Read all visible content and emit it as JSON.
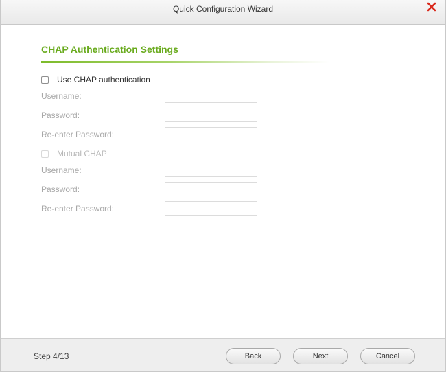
{
  "window": {
    "title": "Quick Configuration Wizard",
    "close_icon": "close-icon",
    "close_color": "#d9291c"
  },
  "section": {
    "title": "CHAP Authentication Settings",
    "accent_color": "#6aab1f"
  },
  "chap": {
    "checkbox_label": "Use CHAP authentication",
    "checked": false,
    "username_label": "Username:",
    "username_value": "",
    "password_label": "Password:",
    "password_value": "",
    "reenter_label": "Re-enter Password:",
    "reenter_value": ""
  },
  "mutual_chap": {
    "checkbox_label": "Mutual CHAP",
    "checked": false,
    "enabled": false,
    "username_label": "Username:",
    "username_value": "",
    "password_label": "Password:",
    "password_value": "",
    "reenter_label": "Re-enter Password:",
    "reenter_value": ""
  },
  "footer": {
    "step_text": "Step 4/13",
    "back_label": "Back",
    "next_label": "Next",
    "cancel_label": "Cancel"
  }
}
